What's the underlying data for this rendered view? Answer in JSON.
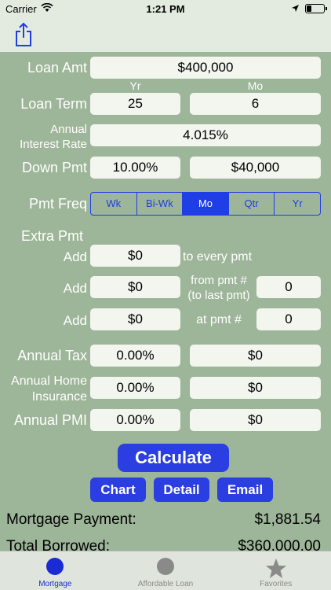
{
  "status": {
    "carrier": "Carrier",
    "time": "1:21 PM",
    "battery_level": 0.3
  },
  "form": {
    "loan_amt": {
      "label": "Loan Amt",
      "value": "$400,000"
    },
    "loan_term": {
      "label": "Loan Term",
      "yr_header": "Yr",
      "mo_header": "Mo",
      "years": "25",
      "months": "6"
    },
    "interest": {
      "label_line1": "Annual",
      "label_line2": "Interest Rate",
      "value": "4.015%"
    },
    "down_pmt": {
      "label": "Down Pmt",
      "percent": "10.00%",
      "amount": "$40,000"
    },
    "pmt_freq": {
      "label": "Pmt Freq",
      "options": [
        "Wk",
        "Bi-Wk",
        "Mo",
        "Qtr",
        "Yr"
      ],
      "selected": "Mo"
    },
    "extra_pmt": {
      "label": "Extra Pmt",
      "row1": {
        "add": "Add",
        "value": "$0",
        "suffix": "to every pmt"
      },
      "row2": {
        "add": "Add",
        "value": "$0",
        "suffix_line1": "from pmt #",
        "suffix_line2": "(to last pmt)",
        "pmt_num": "0"
      },
      "row3": {
        "add": "Add",
        "value": "$0",
        "suffix": "at pmt #",
        "pmt_num": "0"
      }
    },
    "annual_tax": {
      "label": "Annual Tax",
      "percent": "0.00%",
      "amount": "$0"
    },
    "home_insurance": {
      "label_line1": "Annual Home",
      "label_line2": "Insurance",
      "percent": "0.00%",
      "amount": "$0"
    },
    "annual_pmi": {
      "label": "Annual PMI",
      "percent": "0.00%",
      "amount": "$0"
    }
  },
  "actions": {
    "calculate": "Calculate",
    "chart": "Chart",
    "detail": "Detail",
    "email": "Email"
  },
  "results": {
    "mortgage_payment": {
      "label": "Mortgage Payment:",
      "value": "$1,881.54"
    },
    "total_borrowed": {
      "label": "Total Borrowed:",
      "value": "$360,000.00"
    }
  },
  "tabs": [
    {
      "label": "Mortgage",
      "icon": "circle-icon"
    },
    {
      "label": "Affordable Loan",
      "icon": "circle-icon"
    },
    {
      "label": "Favorites",
      "icon": "star-icon"
    }
  ],
  "colors": {
    "background": "#9db598",
    "accent": "#1f3ee6",
    "field": "#f3f5ef"
  }
}
